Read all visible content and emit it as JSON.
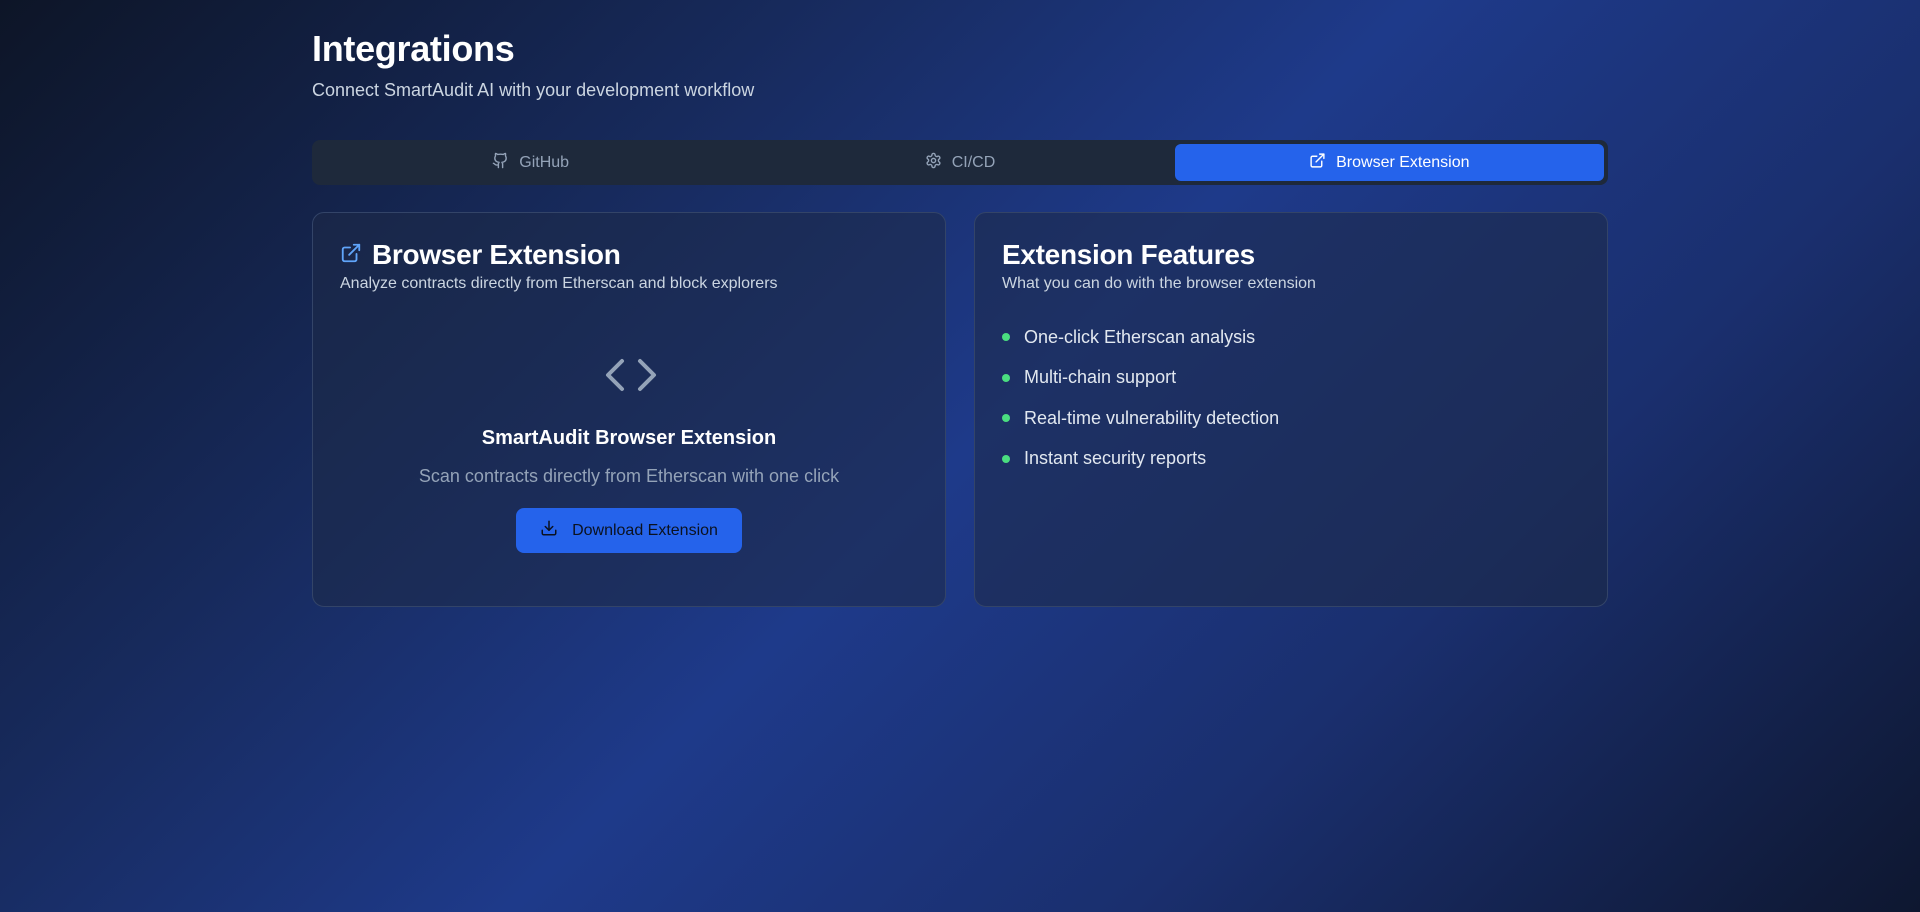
{
  "header": {
    "title": "Integrations",
    "subtitle": "Connect SmartAudit AI with your development workflow"
  },
  "tabs": [
    {
      "label": "GitHub",
      "icon": "github-icon",
      "active": false
    },
    {
      "label": "CI/CD",
      "icon": "gear-icon",
      "active": false
    },
    {
      "label": "Browser Extension",
      "icon": "external-link-icon",
      "active": true
    }
  ],
  "extension_card": {
    "title": "Browser Extension",
    "description": "Analyze contracts directly from Etherscan and block explorers",
    "icon": "code-icon",
    "name": "SmartAudit Browser Extension",
    "tagline": "Scan contracts directly from Etherscan with one click",
    "download_label": "Download Extension"
  },
  "features_card": {
    "title": "Extension Features",
    "description": "What you can do with the browser extension",
    "items": [
      "One-click Etherscan analysis",
      "Multi-chain support",
      "Real-time vulnerability detection",
      "Instant security reports"
    ]
  },
  "colors": {
    "accent": "#2563eb",
    "bullet": "#4ade80",
    "muted_text": "#94a3b8"
  }
}
